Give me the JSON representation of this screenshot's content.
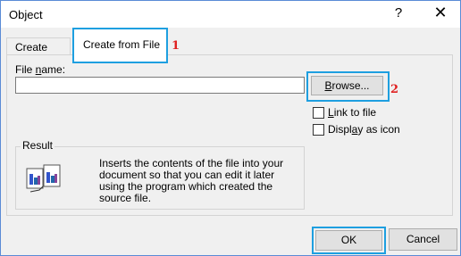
{
  "window": {
    "title": "Object",
    "help_glyph": "?",
    "close_glyph": "✕"
  },
  "tabs": [
    {
      "label": "Create New"
    },
    {
      "label": "Create from File",
      "selected": true
    }
  ],
  "annotations": {
    "tab_marker": "1",
    "browse_marker": "2",
    "color": "#e02020",
    "highlight_color": "#1e9fe0"
  },
  "file": {
    "label_prefix": "File ",
    "label_underlined": "n",
    "label_suffix": "ame:",
    "value": ""
  },
  "browse": {
    "pre": "",
    "underlined": "B",
    "post": "rowse..."
  },
  "options": [
    {
      "pre": "",
      "underlined": "L",
      "post": "ink to file",
      "checked": false
    },
    {
      "pre": "Displ",
      "underlined": "a",
      "post": "y as icon",
      "checked": false
    }
  ],
  "result": {
    "legend": "Result",
    "text": "Inserts the contents of the file into your document so that you can edit it later using the program which created the source file.",
    "icon": "embedded-documents-icon"
  },
  "buttons": {
    "ok": "OK",
    "cancel": "Cancel"
  }
}
